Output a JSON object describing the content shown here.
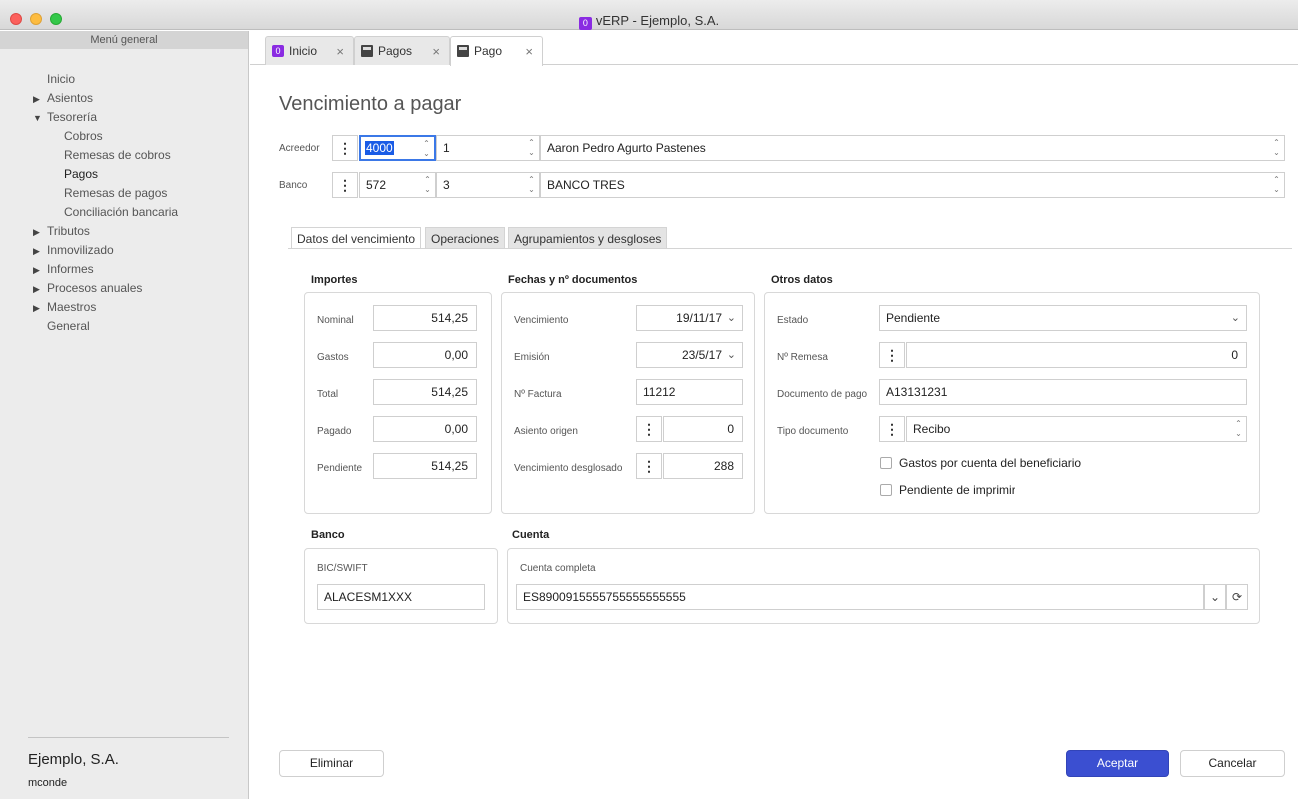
{
  "window": {
    "title": "vERP - Ejemplo, S.A.",
    "app_icon": "0"
  },
  "sidebar": {
    "header": "Menú general",
    "items": [
      {
        "label": "Inicio",
        "level": 0,
        "arrow": ""
      },
      {
        "label": "Asientos",
        "level": 0,
        "arrow": "▶"
      },
      {
        "label": "Tesorería",
        "level": 0,
        "arrow": "▼"
      },
      {
        "label": "Cobros",
        "level": 1
      },
      {
        "label": "Remesas de cobros",
        "level": 1
      },
      {
        "label": "Pagos",
        "level": 1
      },
      {
        "label": "Remesas de pagos",
        "level": 1
      },
      {
        "label": "Conciliación bancaria",
        "level": 1
      },
      {
        "label": "Tributos",
        "level": 0,
        "arrow": "▶"
      },
      {
        "label": "Inmovilizado",
        "level": 0,
        "arrow": "▶"
      },
      {
        "label": "Informes",
        "level": 0,
        "arrow": "▶"
      },
      {
        "label": "Procesos anuales",
        "level": 0,
        "arrow": "▶"
      },
      {
        "label": "Maestros",
        "level": 0,
        "arrow": "▶"
      },
      {
        "label": "General",
        "level": 0,
        "arrow": ""
      }
    ],
    "company": "Ejemplo, S.A.",
    "user": "mconde"
  },
  "tabs": [
    {
      "label": "Inicio",
      "close": "×"
    },
    {
      "label": "Pagos",
      "close": "×"
    },
    {
      "label": "Pago",
      "close": "×"
    }
  ],
  "page": {
    "title": "Vencimiento a pagar"
  },
  "header_fields": {
    "acreedor": {
      "label": "Acreedor",
      "code": "4000",
      "sub": "1",
      "name": "Aaron Pedro Agurto Pastenes"
    },
    "banco": {
      "label": "Banco",
      "code": "572",
      "sub": "3",
      "name": "BANCO TRES"
    }
  },
  "subtabs": [
    "Datos del vencimiento",
    "Operaciones",
    "Agrupamientos y desgloses"
  ],
  "importes": {
    "title": "Importes",
    "nominal": {
      "label": "Nominal",
      "value": "514,25"
    },
    "gastos": {
      "label": "Gastos",
      "value": "0,00"
    },
    "total": {
      "label": "Total",
      "value": "514,25"
    },
    "pagado": {
      "label": "Pagado",
      "value": "0,00"
    },
    "pendiente": {
      "label": "Pendiente",
      "value": "514,25"
    }
  },
  "fechas": {
    "title": "Fechas y nº documentos",
    "vencimiento": {
      "label": "Vencimiento",
      "value": "19/11/17"
    },
    "emision": {
      "label": "Emisión",
      "value": "23/5/17"
    },
    "factura": {
      "label": "Nº Factura",
      "value": "11212"
    },
    "asiento": {
      "label": "Asiento origen",
      "value": "0"
    },
    "desglosado": {
      "label": "Vencimiento desglosado",
      "value": "288"
    }
  },
  "otros": {
    "title": "Otros datos",
    "estado": {
      "label": "Estado",
      "value": "Pendiente"
    },
    "remesa": {
      "label": "Nº Remesa",
      "value": "0"
    },
    "documento": {
      "label": "Documento de pago",
      "value": "A13131231"
    },
    "tipo": {
      "label": "Tipo documento",
      "value": "Recibo"
    },
    "chk_gastos": "Gastos por cuenta del beneficiario",
    "chk_pendiente": "Pendiente de imprimir"
  },
  "banco_section": {
    "title": "Banco",
    "bic_label": "BIC/SWIFT",
    "bic": "ALACESM1XXX"
  },
  "cuenta_section": {
    "title": "Cuenta",
    "label": "Cuenta completa",
    "value": "ES8900915555755555555555"
  },
  "buttons": {
    "eliminar": "Eliminar",
    "aceptar": "Aceptar",
    "cancelar": "Cancelar"
  },
  "colors": {
    "accent": "#3b4fd1",
    "focus": "#3b78e7"
  }
}
